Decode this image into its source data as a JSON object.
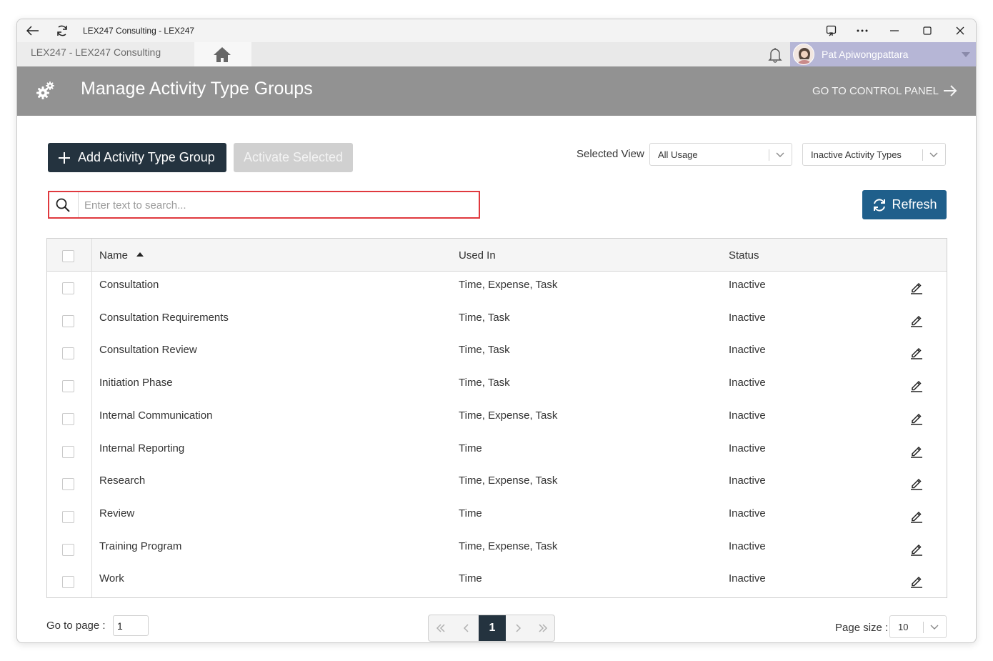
{
  "window": {
    "title": "LEX247 Consulting - LEX247"
  },
  "app": {
    "company": "LEX247  -  LEX247 Consulting",
    "user_name": "Pat Apiwongpattara"
  },
  "page": {
    "title": "Manage Activity Type Groups",
    "control_panel_link": "GO TO CONTROL PANEL"
  },
  "toolbar": {
    "add_label": "Add Activity Type Group",
    "activate_label": "Activate Selected",
    "selected_view_label": "Selected View",
    "view_value": "All Usage",
    "status_filter_value": "Inactive Activity Types",
    "search_placeholder": "Enter text to search...",
    "refresh_label": "Refresh"
  },
  "table": {
    "columns": [
      "Name",
      "Used In",
      "Status"
    ],
    "sort_column": "Name",
    "sort_direction": "ascending",
    "rows": [
      {
        "name": "Consultation",
        "used_in": "Time, Expense, Task",
        "status": "Inactive"
      },
      {
        "name": "Consultation Requirements",
        "used_in": "Time, Task",
        "status": "Inactive"
      },
      {
        "name": "Consultation Review",
        "used_in": "Time, Task",
        "status": "Inactive"
      },
      {
        "name": "Initiation Phase",
        "used_in": "Time, Task",
        "status": "Inactive"
      },
      {
        "name": "Internal Communication",
        "used_in": "Time, Expense, Task",
        "status": "Inactive"
      },
      {
        "name": "Internal Reporting",
        "used_in": "Time",
        "status": "Inactive"
      },
      {
        "name": "Research",
        "used_in": "Time, Expense, Task",
        "status": "Inactive"
      },
      {
        "name": "Review",
        "used_in": "Time",
        "status": "Inactive"
      },
      {
        "name": "Training Program",
        "used_in": "Time, Expense, Task",
        "status": "Inactive"
      },
      {
        "name": "Work",
        "used_in": "Time",
        "status": "Inactive"
      }
    ]
  },
  "footer": {
    "goto_label": "Go to page :",
    "goto_value": "1",
    "current_page": "1",
    "page_size_label": "Page size :",
    "page_size_value": "10"
  },
  "colors": {
    "primary_dark": "#24333f",
    "refresh_blue": "#1f5f8b",
    "header_gray": "#929292",
    "search_highlight": "#e0393e",
    "user_bar": "#b6b6d6"
  }
}
